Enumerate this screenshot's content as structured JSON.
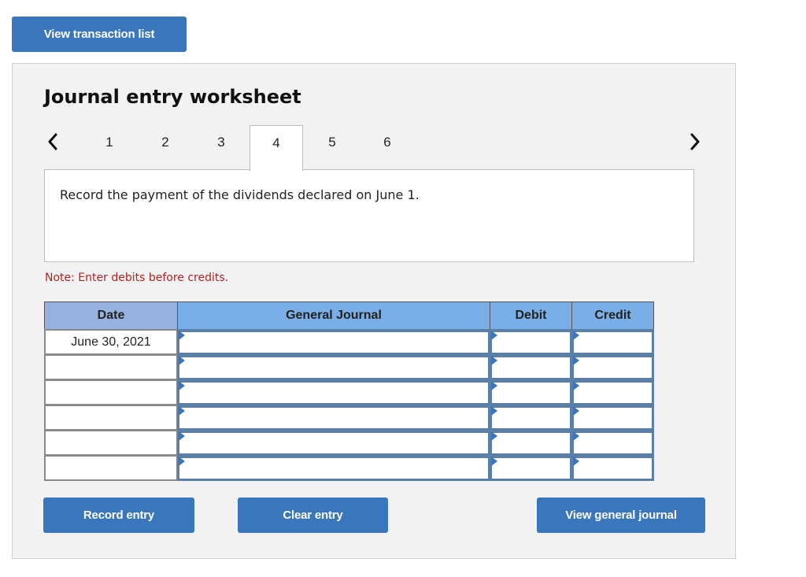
{
  "top_button": {
    "label": "View transaction list"
  },
  "worksheet": {
    "title": "Journal entry worksheet",
    "nav": {
      "prev_icon": "chevron-left-icon",
      "next_icon": "chevron-right-icon",
      "tabs": [
        {
          "label": "1",
          "active": false
        },
        {
          "label": "2",
          "active": false
        },
        {
          "label": "3",
          "active": false
        },
        {
          "label": "4",
          "active": true
        },
        {
          "label": "5",
          "active": false
        },
        {
          "label": "6",
          "active": false
        }
      ]
    },
    "prompt": "Record the payment of the dividends declared on June 1.",
    "note": "Note: Enter debits before credits.",
    "table": {
      "headers": {
        "date": "Date",
        "journal": "General Journal",
        "debit": "Debit",
        "credit": "Credit"
      },
      "rows": [
        {
          "date": "June 30, 2021",
          "journal": "",
          "debit": "",
          "credit": ""
        },
        {
          "date": "",
          "journal": "",
          "debit": "",
          "credit": ""
        },
        {
          "date": "",
          "journal": "",
          "debit": "",
          "credit": ""
        },
        {
          "date": "",
          "journal": "",
          "debit": "",
          "credit": ""
        },
        {
          "date": "",
          "journal": "",
          "debit": "",
          "credit": ""
        },
        {
          "date": "",
          "journal": "",
          "debit": "",
          "credit": ""
        }
      ]
    },
    "buttons": {
      "record": "Record entry",
      "clear": "Clear entry",
      "view_journal": "View general journal"
    }
  },
  "colors": {
    "button_blue": "#3a76bb",
    "date_header": "#97b1e0",
    "header_blue": "#79aee6",
    "note_red": "#b22222",
    "panel_bg": "#f2f2f2"
  }
}
